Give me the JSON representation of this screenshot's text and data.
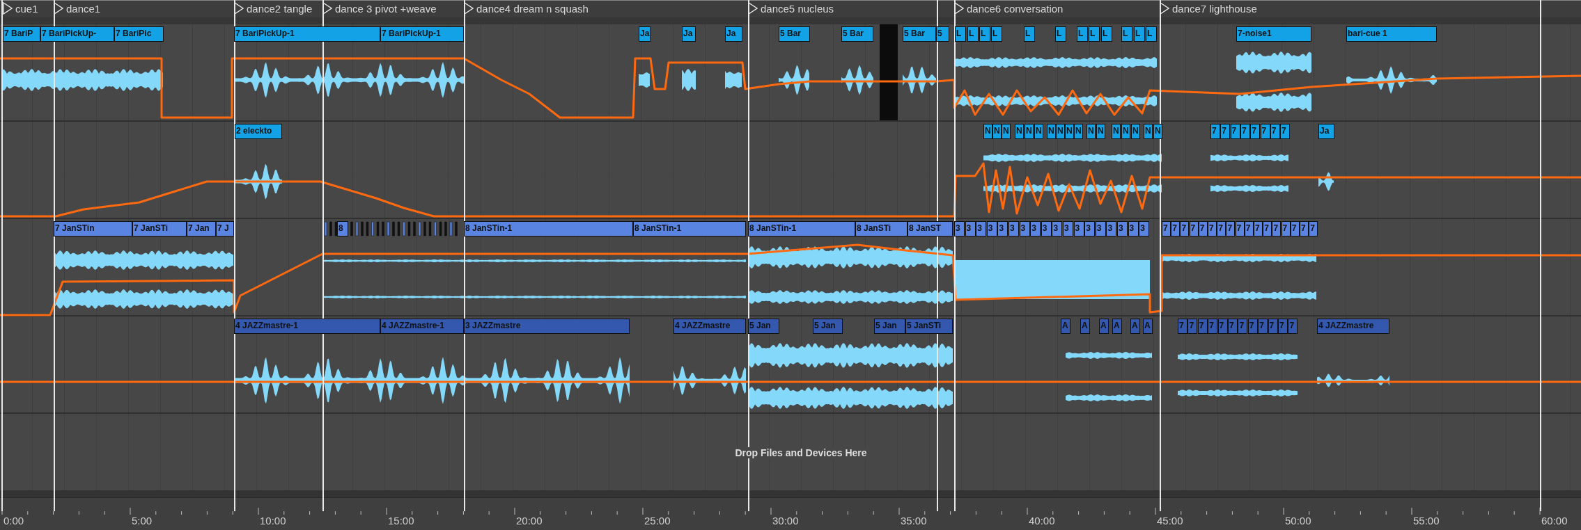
{
  "markers": [
    {
      "label": "cue1"
    },
    {
      "label": "dance1"
    },
    {
      "label": "dance2 tangle"
    },
    {
      "label": "dance 3 pivot +weave"
    },
    {
      "label": "dance4 dream n squash"
    },
    {
      "label": "dance5 nucleus"
    },
    {
      "label": "dance6 conversation"
    },
    {
      "label": "dance7 lighthouse"
    }
  ],
  "tracks": [
    {
      "color": "#14a2e6",
      "clips": [
        {
          "name": "7 BariP"
        },
        {
          "name": "7 BariPickUp-"
        },
        {
          "name": "7 BariPic"
        },
        {
          "name": "7 BariPickUp-1"
        },
        {
          "name": "7 BariPickUp-1"
        },
        {
          "name": "Ja"
        },
        {
          "name": "Ja"
        },
        {
          "name": "Ja"
        },
        {
          "name": "5 Bar"
        },
        {
          "name": "5 Bar"
        },
        {
          "name": "5 Bar"
        },
        {
          "name": "5"
        },
        {
          "name": "L"
        },
        {
          "name": "L"
        },
        {
          "name": "L"
        },
        {
          "name": "L"
        },
        {
          "name": "L"
        },
        {
          "name": "L"
        },
        {
          "name": "L"
        },
        {
          "name": "L"
        },
        {
          "name": "L"
        },
        {
          "name": "L"
        },
        {
          "name": "L"
        },
        {
          "name": "L"
        },
        {
          "name": "7-noise1"
        },
        {
          "name": "bari-cue 1"
        }
      ]
    },
    {
      "color": "#14a2e6",
      "clips": [
        {
          "name": "2 eleckto"
        },
        {
          "name": "N"
        },
        {
          "name": "N"
        },
        {
          "name": "N"
        },
        {
          "name": "N"
        },
        {
          "name": "N"
        },
        {
          "name": "N"
        },
        {
          "name": "N"
        },
        {
          "name": "N"
        },
        {
          "name": "N"
        },
        {
          "name": "N"
        },
        {
          "name": "N"
        },
        {
          "name": "N"
        },
        {
          "name": "N"
        },
        {
          "name": "N"
        },
        {
          "name": "N"
        },
        {
          "name": "N"
        },
        {
          "name": "N"
        },
        {
          "name": "7"
        },
        {
          "name": "7"
        },
        {
          "name": "7"
        },
        {
          "name": "7"
        },
        {
          "name": "7"
        },
        {
          "name": "7"
        },
        {
          "name": "7"
        },
        {
          "name": "7"
        },
        {
          "name": "Ja"
        }
      ]
    },
    {
      "color": "#5a84e2",
      "clips": [
        {
          "name": "7 JanSTin"
        },
        {
          "name": "7 JanSTi"
        },
        {
          "name": "7 Jan"
        },
        {
          "name": "7 J"
        },
        {
          "name": "8"
        },
        {
          "name": "8 JanSTin-1"
        },
        {
          "name": "8 JanSTin-1"
        },
        {
          "name": "8 JanSTin-1"
        },
        {
          "name": "8 JanSTi"
        },
        {
          "name": "8 JanST"
        },
        {
          "name": "3"
        },
        {
          "name": "3"
        },
        {
          "name": "3"
        },
        {
          "name": "3"
        },
        {
          "name": "3"
        },
        {
          "name": "3"
        },
        {
          "name": "3"
        },
        {
          "name": "3"
        },
        {
          "name": "3"
        },
        {
          "name": "3"
        },
        {
          "name": "3"
        },
        {
          "name": "3"
        },
        {
          "name": "3"
        },
        {
          "name": "3"
        },
        {
          "name": "3"
        },
        {
          "name": "3"
        },
        {
          "name": "3"
        },
        {
          "name": "3"
        },
        {
          "name": "7"
        },
        {
          "name": "7"
        },
        {
          "name": "7"
        },
        {
          "name": "7"
        },
        {
          "name": "7"
        },
        {
          "name": "7"
        },
        {
          "name": "7"
        },
        {
          "name": "7"
        },
        {
          "name": "7"
        },
        {
          "name": "7"
        },
        {
          "name": "7"
        },
        {
          "name": "7"
        },
        {
          "name": "7"
        },
        {
          "name": "7"
        },
        {
          "name": "7"
        },
        {
          "name": "7"
        },
        {
          "name": "7"
        }
      ]
    },
    {
      "color": "#3358ad",
      "clips": [
        {
          "name": "4 JAZZmastre-1"
        },
        {
          "name": "4 JAZZmastre-1"
        },
        {
          "name": "3 JAZZmastre"
        },
        {
          "name": "4 JAZZmastre"
        },
        {
          "name": "5 Jan"
        },
        {
          "name": "5 Jan"
        },
        {
          "name": "5 Jan"
        },
        {
          "name": "5 JanSTi"
        },
        {
          "name": "A"
        },
        {
          "name": "A"
        },
        {
          "name": "A"
        },
        {
          "name": "A"
        },
        {
          "name": "A"
        },
        {
          "name": "A"
        },
        {
          "name": "7"
        },
        {
          "name": "7"
        },
        {
          "name": "7"
        },
        {
          "name": "7"
        },
        {
          "name": "7"
        },
        {
          "name": "7"
        },
        {
          "name": "7"
        },
        {
          "name": "7"
        },
        {
          "name": "7"
        },
        {
          "name": "7"
        },
        {
          "name": "7"
        },
        {
          "name": "7"
        },
        {
          "name": "4 JAZZmastre"
        }
      ]
    }
  ],
  "drop_hint": "Drop Files and Devices Here",
  "ruler": {
    "labels": [
      "0:00",
      "5:00",
      "10:00",
      "15:00",
      "20:00",
      "25:00",
      "30:00",
      "35:00",
      "40:00",
      "45:00",
      "50:00",
      "55:00",
      "60:00"
    ]
  }
}
